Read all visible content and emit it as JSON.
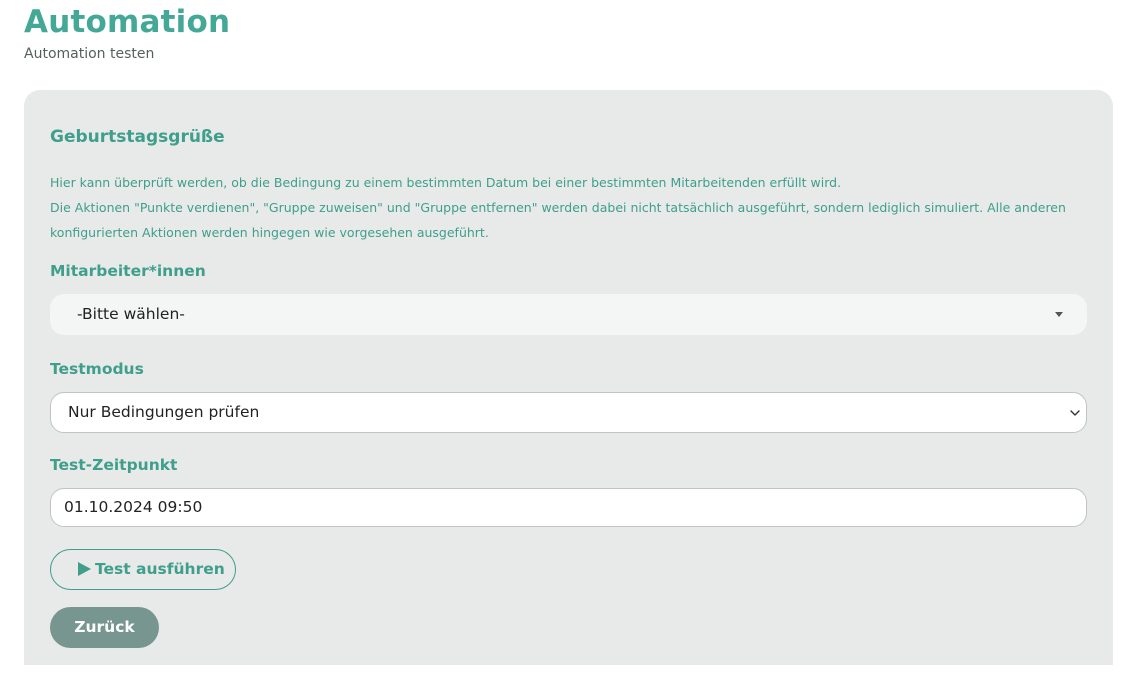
{
  "header": {
    "title": "Automation",
    "subtitle": "Automation testen"
  },
  "card": {
    "title": "Geburtstagsgrüße",
    "description": [
      "Hier kann überprüft werden, ob die Bedingung zu einem bestimmten Datum bei einer bestimmten Mitarbeitenden erfüllt wird.",
      "Die Aktionen \"Punkte verdienen\", \"Gruppe zuweisen\" und \"Gruppe entfernen\" werden dabei nicht tatsächlich ausgeführt, sondern lediglich simuliert. Alle anderen konfigurierten Aktionen werden hingegen wie vorgesehen ausgeführt."
    ]
  },
  "form": {
    "employee": {
      "label": "Mitarbeiter*innen",
      "value": "-Bitte wählen-"
    },
    "mode": {
      "label": "Testmodus",
      "value": "Nur Bedingungen prüfen"
    },
    "timestamp": {
      "label": "Test-Zeitpunkt",
      "value": "01.10.2024 09:50"
    }
  },
  "buttons": {
    "run": {
      "label": "Test ausführen",
      "icon": "play-icon"
    },
    "back": {
      "label": "Zurück"
    }
  },
  "colors": {
    "accent": "#44a896",
    "card_background": "#e7eae8",
    "back_button": "#77968f"
  }
}
